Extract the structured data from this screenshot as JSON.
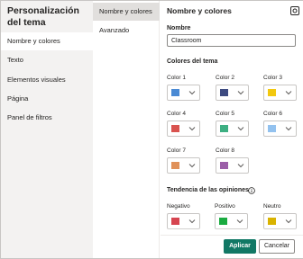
{
  "sidebar": {
    "title": "Personalización del tema",
    "items": [
      {
        "label": "Nombre y colores",
        "active": true
      },
      {
        "label": "Texto"
      },
      {
        "label": "Elementos visuales"
      },
      {
        "label": "Página"
      },
      {
        "label": "Panel de filtros"
      }
    ]
  },
  "subnav": {
    "items": [
      {
        "label": "Nombre y colores",
        "active": true
      },
      {
        "label": "Avanzado"
      }
    ]
  },
  "main": {
    "title": "Nombre y colores",
    "gear_icon": "settings-icon",
    "name_label": "Nombre",
    "name_value": "Classroom",
    "theme_colors_label": "Colores del tema",
    "colors": [
      {
        "label": "Color 1",
        "hex": "#4a8ad4"
      },
      {
        "label": "Color 2",
        "hex": "#3d4a80"
      },
      {
        "label": "Color 3",
        "hex": "#f2c80f"
      },
      {
        "label": "Color 4",
        "hex": "#d9534f"
      },
      {
        "label": "Color 5",
        "hex": "#3daf82"
      },
      {
        "label": "Color 6",
        "hex": "#93c2ef"
      },
      {
        "label": "Color 7",
        "hex": "#e09159"
      },
      {
        "label": "Color 8",
        "hex": "#9b5ea8"
      }
    ],
    "sentiment_label": "Tendencia de las opiniones",
    "sentiment": [
      {
        "label": "Negativo",
        "hex": "#d64550"
      },
      {
        "label": "Positivo",
        "hex": "#1aab40"
      },
      {
        "label": "Neutro",
        "hex": "#d9b300"
      }
    ]
  },
  "footer": {
    "apply_label": "Aplicar",
    "cancel_label": "Cancelar"
  },
  "colors": {
    "accent": "#117865",
    "sidebar_bg": "#f3f2f1"
  }
}
